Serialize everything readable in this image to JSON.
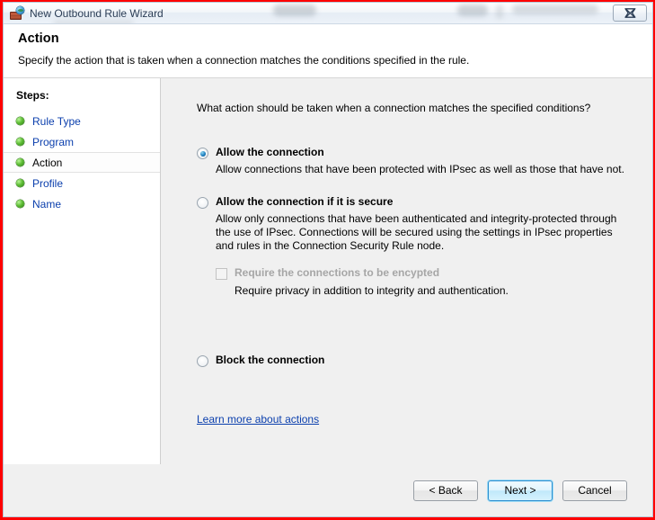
{
  "window": {
    "title": "New Outbound Rule Wizard",
    "icon": "firewall-globe-brick-icon",
    "close_label": "Close",
    "close_icon": "close-x-icon"
  },
  "header": {
    "title": "Action",
    "subtitle": "Specify the action that is taken when a connection matches the conditions specified in the rule."
  },
  "sidebar": {
    "label": "Steps:",
    "items": [
      {
        "label": "Rule Type",
        "current": false
      },
      {
        "label": "Program",
        "current": false
      },
      {
        "label": "Action",
        "current": true
      },
      {
        "label": "Profile",
        "current": false
      },
      {
        "label": "Name",
        "current": false
      }
    ]
  },
  "main": {
    "question": "What action should be taken when a connection matches the specified conditions?",
    "options": [
      {
        "title": "Allow the connection",
        "description": "Allow connections that have been protected with IPsec as well as those that have not.",
        "selected": true
      },
      {
        "title": "Allow the connection if it is secure",
        "description": "Allow only connections that have been authenticated and integrity-protected through the use of IPsec.  Connections will be secured using the settings in IPsec properties and rules in the Connection Security Rule node.",
        "selected": false
      },
      {
        "title": "Block the connection",
        "description": "",
        "selected": false
      }
    ],
    "encrypt": {
      "label": "Require the connections to be encypted",
      "description": "Require privacy in addition to integrity and authentication.",
      "checked": false,
      "disabled": true
    },
    "learn_more": "Learn more about actions"
  },
  "footer": {
    "back": "< Back",
    "next": "Next >",
    "cancel": "Cancel"
  },
  "colors": {
    "link": "#0b3fad",
    "accent": "#1d7fc0",
    "disabled_text": "#a6a6a6",
    "outer_border": "#ff0000",
    "sidebar_bg": "#ffffff",
    "content_bg": "#f0f0f0"
  }
}
